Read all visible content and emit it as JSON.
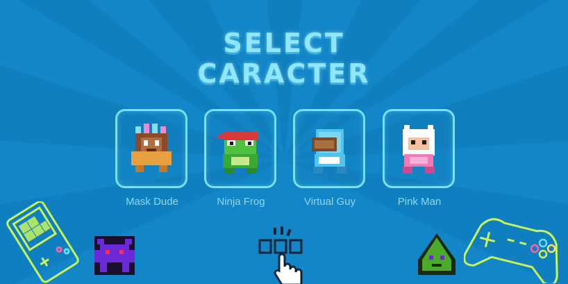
{
  "screen": {
    "title_line_1": "SELECT",
    "title_line_2": "CARACTER"
  },
  "characters": [
    {
      "name": "Mask Dude",
      "icon": "mask-dude-sprite"
    },
    {
      "name": "Ninja Frog",
      "icon": "ninja-frog-sprite"
    },
    {
      "name": "Virtual Guy",
      "icon": "virtual-guy-sprite"
    },
    {
      "name": "Pink Man",
      "icon": "pink-man-sprite"
    }
  ],
  "decorations": [
    "handheld-console-icon",
    "purple-space-invader-icon",
    "pointer-hand-icon",
    "green-alien-icon",
    "gamepad-icon"
  ],
  "colors": {
    "background": "#1386c7",
    "title": "#8fe6ff",
    "card_border": "#7ae1f4",
    "label": "#8fd8f0",
    "neon_green": "#c8f55a"
  }
}
